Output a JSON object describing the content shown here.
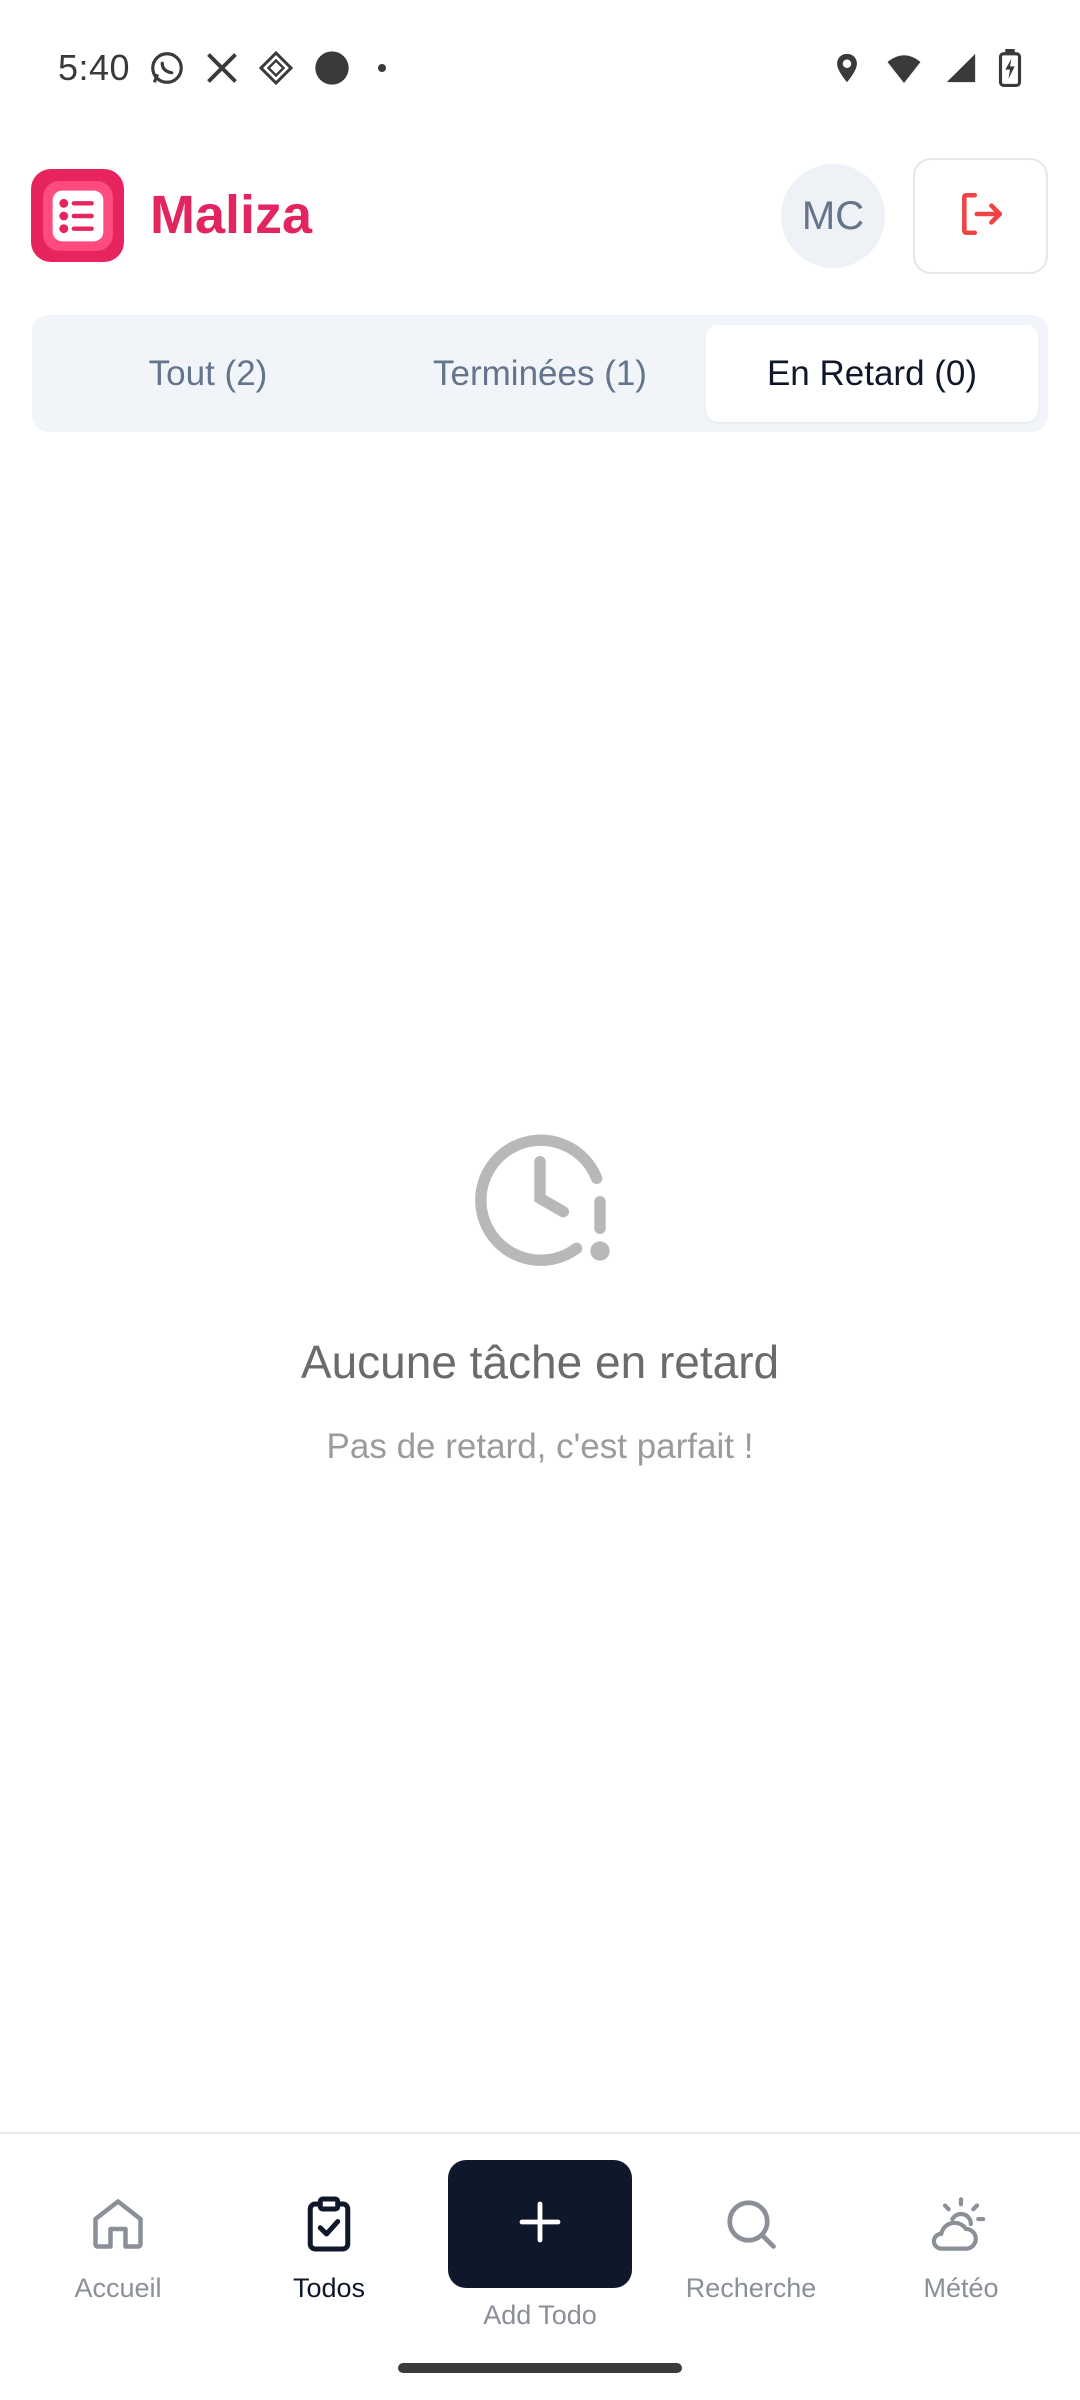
{
  "status_bar": {
    "time": "5:40",
    "left_icons": [
      "whatsapp-icon",
      "x-icon",
      "app-icon",
      "circle-icon",
      "dot-icon"
    ],
    "right_icons": [
      "location-icon",
      "wifi-icon",
      "signal-icon",
      "battery-icon"
    ]
  },
  "header": {
    "app_name": "Maliza",
    "avatar_initials": "MC",
    "brand_color": "#e2245f"
  },
  "tabs": [
    {
      "label": "Tout (2)",
      "active": false
    },
    {
      "label": "Terminées (1)",
      "active": false
    },
    {
      "label": "En Retard (0)",
      "active": true
    }
  ],
  "empty_state": {
    "icon": "clock-alert-icon",
    "title": "Aucune tâche en retard",
    "subtitle": "Pas de retard, c'est parfait !"
  },
  "bottom_nav": {
    "items": [
      {
        "label": "Accueil",
        "icon": "home-icon",
        "active": false
      },
      {
        "label": "Todos",
        "icon": "clipboard-check-icon",
        "active": true
      },
      {
        "label": "Recherche",
        "icon": "search-icon",
        "active": false
      },
      {
        "label": "Météo",
        "icon": "weather-icon",
        "active": false
      }
    ],
    "add_label": "Add Todo"
  }
}
